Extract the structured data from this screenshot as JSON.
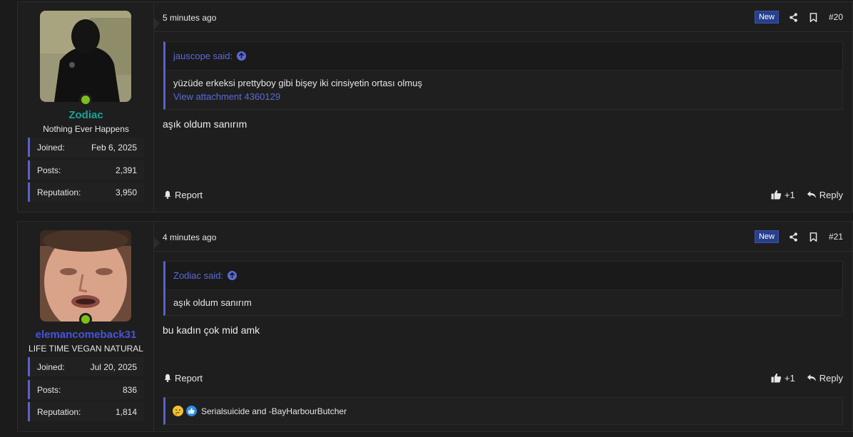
{
  "posts": [
    {
      "user": {
        "name": "Zodiac",
        "title": "Nothing Ever Happens",
        "name_color": "#1aa39a"
      },
      "stats": [
        {
          "label": "Joined:",
          "value": "Feb 6, 2025"
        },
        {
          "label": "Posts:",
          "value": "2,391"
        },
        {
          "label": "Reputation:",
          "value": "3,950"
        }
      ],
      "time": "5 minutes ago",
      "badge": "New",
      "number": "#20",
      "quote": {
        "author": "jauscope said:",
        "text": "yüzüde erkeksi prettyboy gibi bişey iki cinsiyetin ortası olmuş",
        "attachment": "View attachment 4360129"
      },
      "message": "aşık oldum sanırım",
      "footer": {
        "report": "Report",
        "like": "+1",
        "reply": "Reply"
      }
    },
    {
      "user": {
        "name": "elemancomeback31",
        "title": "LIFE TIME VEGAN NATURAL",
        "name_color": "#4754d9"
      },
      "stats": [
        {
          "label": "Joined:",
          "value": "Jul 20, 2025"
        },
        {
          "label": "Posts:",
          "value": "836"
        },
        {
          "label": "Reputation:",
          "value": "1,814"
        }
      ],
      "time": "4 minutes ago",
      "badge": "New",
      "number": "#21",
      "quote": {
        "author": "Zodiac said:",
        "text": "aşık oldum sanırım"
      },
      "message": "bu kadın çok mid amk",
      "footer": {
        "report": "Report",
        "like": "+1",
        "reply": "Reply"
      },
      "reactions": {
        "text": "Serialsuicide and -BayHarbourButcher",
        "icons": [
          "thinking-face-icon",
          "like-reaction-icon"
        ]
      }
    }
  ],
  "colors": {
    "accent": "#5a62c8",
    "link": "#5a6bd6",
    "badge": "#283f8b",
    "online": "#7cbf1a"
  }
}
